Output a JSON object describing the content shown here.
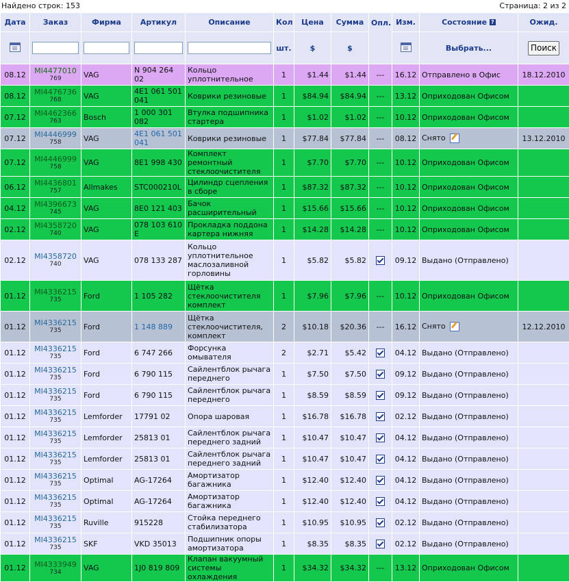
{
  "topbar": {
    "found": "Найдено строк: 153",
    "page": "Страница: 2 из 2"
  },
  "headers": {
    "date": "Дата",
    "order": "Заказ",
    "firm": "Фирма",
    "article": "Артикул",
    "description": "Описание",
    "qty": "Кол",
    "qty_unit": "шт.",
    "price": "Цена",
    "price_unit": "$",
    "sum": "Сумма",
    "sum_unit": "$",
    "paid": "Опл.",
    "changed": "Изм.",
    "status": "Состояние",
    "status_select": "Выбрать...",
    "expected": "Ожид.",
    "search_button": "Поиск"
  },
  "icons": {
    "calendar": "calendar-icon",
    "help": "help-icon",
    "check": "checkbox-icon",
    "edit": "edit-note-icon"
  },
  "colors": {
    "purple": "#dca8f4",
    "green": "#14c84e",
    "gray": "#b6c2d4",
    "lavender": "#e1e4fb",
    "header": "#e1e5f6"
  },
  "rows": [
    {
      "style": "purple",
      "date": "08.12",
      "order": "MI4477010",
      "order_sub": "769",
      "firm": "VAG",
      "article": "N 904 264 02",
      "desc": "Кольцо уплотнительное",
      "qty": "1",
      "price": "$1.44",
      "sum": "$1.44",
      "paid": "---",
      "changed": "16.12",
      "status": "Отправлено в Офис",
      "expected": "18.12.2010"
    },
    {
      "style": "green",
      "date": "08.12",
      "order": "MI4476736",
      "order_sub": "768",
      "firm": "VAG",
      "article": "4E1 061 501 041",
      "desc": "Коврики резиновые",
      "qty": "1",
      "price": "$84.94",
      "sum": "$84.94",
      "paid": "---",
      "changed": "13.12",
      "status": "Оприходован Офисом",
      "expected": ""
    },
    {
      "style": "green",
      "date": "07.12",
      "order": "MI4462366",
      "order_sub": "763",
      "firm": "Bosch",
      "article": "1 000 301 082",
      "desc": "Втулка подшипника стартера",
      "qty": "1",
      "price": "$1.02",
      "sum": "$1.02",
      "paid": "---",
      "changed": "10.12",
      "status": "Оприходован Офисом",
      "expected": ""
    },
    {
      "style": "gray",
      "date": "07.12",
      "order": "MI4446999",
      "order_sub": "758",
      "firm": "VAG",
      "article": "4E1 061 501 041",
      "desc": "Коврики резиновые",
      "qty": "1",
      "price": "$77.84",
      "sum": "$77.84",
      "paid": "---",
      "changed": "08.12",
      "status": "Снято",
      "expected": "13.12.2010",
      "art_link": true,
      "edit": true
    },
    {
      "style": "green",
      "date": "07.12",
      "order": "MI4446999",
      "order_sub": "758",
      "firm": "VAG",
      "article": "8E1 998 430",
      "desc": "Комплект ремонтный стеклоочистителя",
      "qty": "1",
      "price": "$7.70",
      "sum": "$7.70",
      "paid": "---",
      "changed": "10.12",
      "status": "Оприходован Офисом",
      "expected": ""
    },
    {
      "style": "green",
      "date": "06.12",
      "order": "MI4436801",
      "order_sub": "757",
      "firm": "Allmakes",
      "article": "STC000210L",
      "desc": "Цилиндр сцепления в сборе",
      "qty": "1",
      "price": "$87.32",
      "sum": "$87.32",
      "paid": "---",
      "changed": "10.12",
      "status": "Оприходован Офисом",
      "expected": ""
    },
    {
      "style": "green",
      "date": "04.12",
      "order": "MI4396673",
      "order_sub": "745",
      "firm": "VAG",
      "article": "8E0 121 403",
      "desc": "Бачок расширительный",
      "qty": "1",
      "price": "$15.66",
      "sum": "$15.66",
      "paid": "---",
      "changed": "10.12",
      "status": "Оприходован Офисом",
      "expected": ""
    },
    {
      "style": "green",
      "date": "02.12",
      "order": "MI4358720",
      "order_sub": "740",
      "firm": "VAG",
      "article": "078 103 610 E",
      "desc": "Прокладка поддона картера нижняя",
      "qty": "1",
      "price": "$14.28",
      "sum": "$14.28",
      "paid": "---",
      "changed": "10.12",
      "status": "Оприходован Офисом",
      "expected": ""
    },
    {
      "style": "lav",
      "date": "02.12",
      "order": "MI4358720",
      "order_sub": "740",
      "firm": "VAG",
      "article": "078 133 287",
      "desc": "Кольцо уплотнительное маслозаливной горловины",
      "qty": "1",
      "price": "$5.82",
      "sum": "$5.82",
      "paid": "check",
      "changed": "09.12",
      "status": "Выдано (Отправлено)",
      "expected": "",
      "h": 59
    },
    {
      "style": "green",
      "date": "01.12",
      "order": "MI4336215",
      "order_sub": "735",
      "firm": "Ford",
      "article": "1 105 282",
      "desc": "Щётка стеклоочистителя комплект",
      "qty": "1",
      "price": "$7.96",
      "sum": "$7.96",
      "paid": "---",
      "changed": "10.12",
      "status": "Оприходован Офисом",
      "expected": "",
      "h": 45
    },
    {
      "style": "gray",
      "date": "01.12",
      "order": "MI4336215",
      "order_sub": "735",
      "firm": "Ford",
      "article": "1 148 889",
      "desc": "Щётка стеклоочистителя, комплект",
      "qty": "2",
      "price": "$10.18",
      "sum": "$20.36",
      "paid": "---",
      "changed": "16.12",
      "status": "Снято",
      "expected": "12.12.2010",
      "art_link": true,
      "edit": true,
      "h": 45
    },
    {
      "style": "lav",
      "date": "01.12",
      "order": "MI4336215",
      "order_sub": "735",
      "firm": "Ford",
      "article": "6 747 266",
      "desc": "Форсунка омывателя",
      "qty": "2",
      "price": "$2.71",
      "sum": "$5.42",
      "paid": "check",
      "changed": "04.12",
      "status": "Выдано (Отправлено)",
      "expected": ""
    },
    {
      "style": "lav",
      "date": "01.12",
      "order": "MI4336215",
      "order_sub": "735",
      "firm": "Ford",
      "article": "6 790 115",
      "desc": "Сайлентблок рычага переднего",
      "qty": "1",
      "price": "$7.50",
      "sum": "$7.50",
      "paid": "check",
      "changed": "09.12",
      "status": "Выдано (Отправлено)",
      "expected": ""
    },
    {
      "style": "lav",
      "date": "01.12",
      "order": "MI4336215",
      "order_sub": "735",
      "firm": "Ford",
      "article": "6 790 115",
      "desc": "Сайлентблок рычага переднего",
      "qty": "1",
      "price": "$8.59",
      "sum": "$8.59",
      "paid": "check",
      "changed": "09.12",
      "status": "Выдано (Отправлено)",
      "expected": ""
    },
    {
      "style": "lav",
      "date": "01.12",
      "order": "MI4336215",
      "order_sub": "735",
      "firm": "Lemforder",
      "article": "17791 02",
      "desc": "Опора шаровая",
      "qty": "1",
      "price": "$16.78",
      "sum": "$16.78",
      "paid": "check",
      "changed": "02.12",
      "status": "Выдано (Отправлено)",
      "expected": ""
    },
    {
      "style": "lav",
      "date": "01.12",
      "order": "MI4336215",
      "order_sub": "735",
      "firm": "Lemforder",
      "article": "25813 01",
      "desc": "Сайлентблок рычага переднего задний",
      "qty": "1",
      "price": "$10.47",
      "sum": "$10.47",
      "paid": "check",
      "changed": "04.12",
      "status": "Выдано (Отправлено)",
      "expected": ""
    },
    {
      "style": "lav",
      "date": "01.12",
      "order": "MI4336215",
      "order_sub": "735",
      "firm": "Lemforder",
      "article": "25813 01",
      "desc": "Сайлентблок рычага переднего задний",
      "qty": "1",
      "price": "$10.47",
      "sum": "$10.47",
      "paid": "check",
      "changed": "04.12",
      "status": "Выдано (Отправлено)",
      "expected": ""
    },
    {
      "style": "lav",
      "date": "01.12",
      "order": "MI4336215",
      "order_sub": "735",
      "firm": "Optimal",
      "article": "AG-17264",
      "desc": "Амортизатор багажника",
      "qty": "1",
      "price": "$12.40",
      "sum": "$12.40",
      "paid": "check",
      "changed": "04.12",
      "status": "Выдано (Отправлено)",
      "expected": ""
    },
    {
      "style": "lav",
      "date": "01.12",
      "order": "MI4336215",
      "order_sub": "735",
      "firm": "Optimal",
      "article": "AG-17264",
      "desc": "Амортизатор багажника",
      "qty": "1",
      "price": "$12.40",
      "sum": "$12.40",
      "paid": "check",
      "changed": "04.12",
      "status": "Выдано (Отправлено)",
      "expected": ""
    },
    {
      "style": "lav",
      "date": "01.12",
      "order": "MI4336215",
      "order_sub": "735",
      "firm": "Ruville",
      "article": "915228",
      "desc": "Стойка переднего стабилизатора",
      "qty": "1",
      "price": "$10.95",
      "sum": "$10.95",
      "paid": "check",
      "changed": "02.12",
      "status": "Выдано (Отправлено)",
      "expected": ""
    },
    {
      "style": "lav",
      "date": "01.12",
      "order": "MI4336215",
      "order_sub": "735",
      "firm": "SKF",
      "article": "VKD 35013",
      "desc": "Подшипник опоры амортизатора",
      "qty": "1",
      "price": "$8.35",
      "sum": "$8.35",
      "paid": "check",
      "changed": "02.12",
      "status": "Выдано (Отправлено)",
      "expected": ""
    },
    {
      "style": "green",
      "date": "01.12",
      "order": "MI4333949",
      "order_sub": "734",
      "firm": "VAG",
      "article": "1J0 819 809",
      "desc": "Клапан вакуумный системы охлаждения",
      "qty": "1",
      "price": "$34.32",
      "sum": "$34.32",
      "paid": "---",
      "changed": "13.12",
      "status": "Оприходован Офисом",
      "expected": ""
    }
  ]
}
